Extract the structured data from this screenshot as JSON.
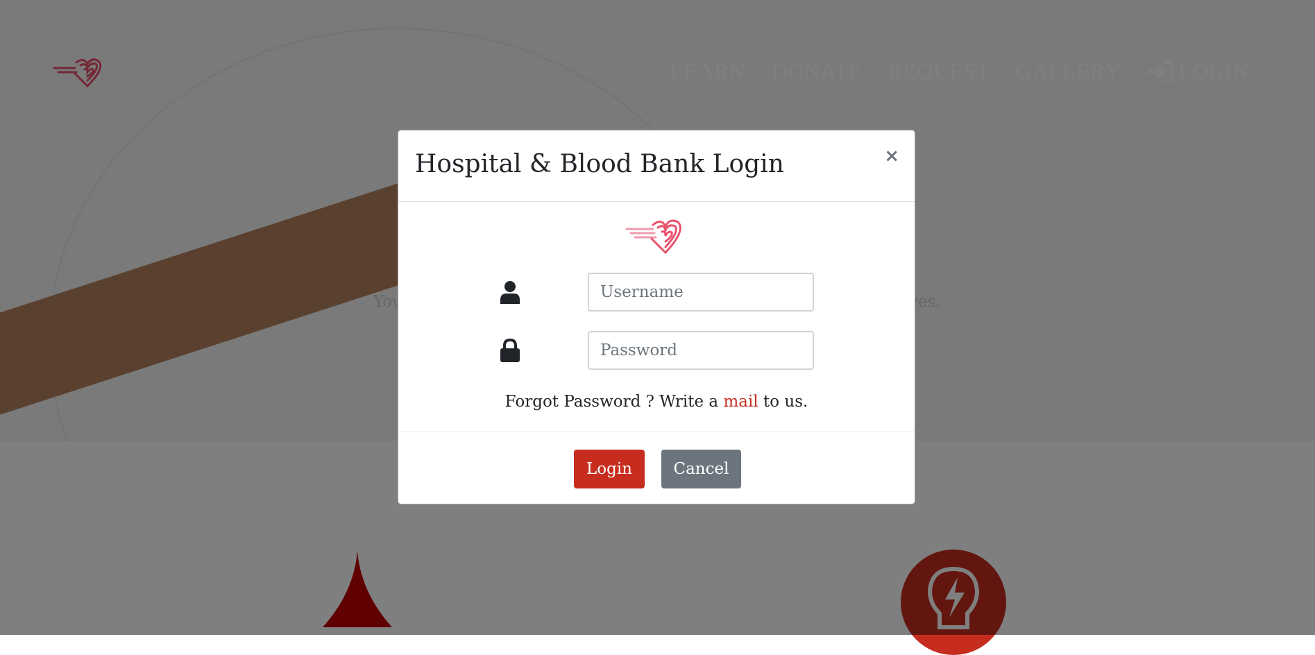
{
  "nav": {
    "items": [
      {
        "label": "LEARN"
      },
      {
        "label": "DONATE"
      },
      {
        "label": "REQUEST"
      },
      {
        "label": "GALLERY"
      },
      {
        "label": "LOGIN",
        "icon": "sign-in-icon"
      }
    ]
  },
  "hero": {
    "tagline_start": "You",
    "tagline_end": "ves."
  },
  "modal": {
    "title": "Hospital & Blood Bank Login",
    "close_label": "×",
    "username_placeholder": "Username",
    "password_placeholder": "Password",
    "forgot_prefix": "Forgot Password ? Write a ",
    "forgot_link": "mail",
    "forgot_suffix": " to us.",
    "login_button": "Login",
    "cancel_button": "Cancel"
  },
  "colors": {
    "accent": "#c62d1f",
    "secondary": "#6c757d",
    "logo_pink": "#e8506b"
  },
  "icons": {
    "username": "user-icon",
    "password": "lock-icon",
    "logo": "heart-logo-icon"
  }
}
